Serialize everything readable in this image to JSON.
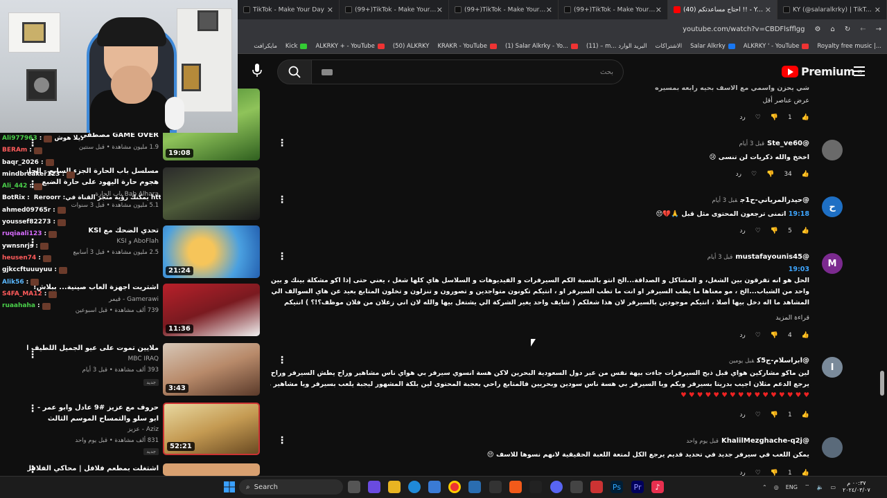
{
  "browser": {
    "tabs": [
      {
        "title": "TikTok - Make Your Day",
        "active": false
      },
      {
        "title": "(99+)TikTok - Make Your Day",
        "active": false
      },
      {
        "title": "(99+)TikTok - Make Your Day",
        "active": false
      },
      {
        "title": "(99+)TikTok - Make Your Day",
        "active": false
      },
      {
        "title": "(40) احتاج مساعدتكم !! - YouTube",
        "active": true
      },
      {
        "title": "KY (@salaralkrky) | TikTok(+99)",
        "active": false
      }
    ],
    "url": "youtube.com/watch?v=CBDFlsfflgg",
    "bookmarks": [
      "مايكرافت",
      "Kick",
      "ALKRKY + - YouTube",
      "(50) ALKRKY",
      "KRAKR - YouTube",
      "(1) Salar Alkrky - Yo...",
      "(11) – m... البريد الوارد",
      "الاشتراكات",
      "Salar Alkrky",
      "ALKRKY ' - YouTube",
      "Royalty free music |..."
    ]
  },
  "youtube": {
    "logo": "Premium",
    "logo_sup": "IQ",
    "search_placeholder": "بحث"
  },
  "chat": [
    {
      "user": "Ali977963",
      "text": "ديلا هوش",
      "color": "green"
    },
    {
      "user": "BERAm",
      "text": "",
      "color": "red"
    },
    {
      "user": "baqr_2026",
      "text": "",
      "color": "wht"
    },
    {
      "user": "mindbreaker123",
      "text": "",
      "color": "wht"
    },
    {
      "user": "Ali_442",
      "text": "",
      "color": "green"
    },
    {
      "user": "BotRix",
      "text": "Reroorr :يمكنك رؤية متجر القناة في https://botrix.live/k/alkrky99/shop",
      "color": "wht"
    },
    {
      "user": "ahmed09765r",
      "text": "",
      "color": "wht"
    },
    {
      "user": "youssef82273",
      "text": "",
      "color": "wht"
    },
    {
      "user": "ruqiaali123",
      "text": "",
      "color": "pur"
    },
    {
      "user": "ywnsnrjs",
      "text": "",
      "color": "wht"
    },
    {
      "user": "heusen74",
      "text": "",
      "color": "red"
    },
    {
      "user": "gjkccftuuuyuu",
      "text": "",
      "color": "wht"
    },
    {
      "user": "Alik56",
      "text": "",
      "color": "blu"
    },
    {
      "user": "S4FA_MA12",
      "text": "",
      "color": "red"
    },
    {
      "user": "ruaahaha",
      "text": "",
      "color": "green"
    }
  ],
  "related": [
    {
      "title": "GAME OVER مصطفى",
      "channel": "",
      "meta": "1.9 مليون مشاهدة • قبل سنتين",
      "duration": "19:08"
    },
    {
      "title": "مسلسل باب الحارة الجزء السابع - الحلقة 22",
      "title2": "هجوم حارة اليهود على حارة الضبع",
      "channel": "Bab Alhara باب الحارة",
      "meta": "5.1 مليون مشاهدة • قبل 3 سنوات",
      "duration": ""
    },
    {
      "title": "تحدي الضحك مع KSI",
      "channel": "AboFlah و KSI",
      "meta": "2.5 مليون مشاهدة • قبل 3 أسابيع",
      "duration": "21:24"
    },
    {
      "title": "اشتريت اجهزة العاب صينية... ببلاش!",
      "channel": "Gamerawi - قيمر",
      "meta": "739 ألف مشاهدة • قبل اسبوعين",
      "duration": "11:36"
    },
    {
      "title": "ملايين تموت على عيو الجميل اللطيف الجنتل",
      "channel": "MBC IRAQ",
      "meta": "393 ألف مشاهدة • قبل 3 أيام",
      "duration": "3:43",
      "new": "جديد"
    },
    {
      "title": "حروف مع عزيز #9 عادل وابو عمر -",
      "title2": "ابو سلو والتمساح الموسم الثالث",
      "channel": "Aziz - عزيز",
      "meta": "831 ألف مشاهدة • قبل يوم واحد",
      "duration": "52:21",
      "new": "جديد"
    },
    {
      "title": "اشتغلت بمطعم فلافل | محاكي الفلافل !!",
      "channel": "",
      "meta": "",
      "duration": ""
    }
  ],
  "comments": [
    {
      "user": "",
      "time": "",
      "text": "شي يحزن واسمي مع الاسف بحيه رابعه بمسيره",
      "extra": "عرض عناصر أقل",
      "likes": "1",
      "reply": "رد"
    },
    {
      "user": "@Ste_ve60",
      "time": "قبل 3 أيام",
      "text": "اخخخ والله ذكريات لن تنسى",
      "likes": "34",
      "reply": "رد"
    },
    {
      "user": "@حيدرالمرياني-ح1ج",
      "time": "قبل 3 أيام",
      "ts": "19:18",
      "text": "اتمنى ترجعون المحتوى مثل قبل",
      "likes": "5",
      "reply": "رد"
    },
    {
      "user": "@mustafayounis45",
      "time": "قبل 3 أيام",
      "ts": "19:03",
      "text": "الحل هو انه تفرقون بين الشغل، و المشاكل و الصداقة...الخ انتو بالنسبة الكم السيرفرات و الفيديوهات و السلاسل هاي كلها شغل ، يعني حتى إذا اكو مشكلة بينك و بين واحد من الشباب...الخ ، مو معناها ما يطب السيرفر او انت ما تطب السيرفر او ، انتيكم تكونون متواجدين و تصورون و تنزلون و تخلون المتابع بعيد عن هاي السوالف الي المشاهد ما اله دخل بيها أصلا ، انتيكم موجودين بالسيرفر لان هذا شغلكم ( شايف واحد يغير الشركة الي يشتغل بيها والله لان اني زعلان من فلان موظف؟!؟ ) انتيكم موجودين بالسيرفر تنزلون محتوى حلو عادي ولا كانما اكو شي و لكن مثلا إذا انتو صدق متزاعلين لا تنزلون فيديوهات سوية و بنفس الوقت لا تحاول تبتعد..",
      "more": "قراءة المزيد",
      "likes": "4",
      "reply": "رد"
    },
    {
      "user": "@ابراسلام-ج5ك",
      "time": "قبل يومين",
      "text": "لين ماكو مشاركين هواي قبل ذبح السيرفرات جاءت بيهة نفس من عير دول السعودية البحرين لاكن هسة انسوي سيرفر بي هواي ناس مشاهير وراح يطش السيرفر وراح يرجع الدعم مثلان اجيب بدريتا بسيرفر ويكم ويا السيرفر بي هسة ناس سودين وبحريين فالمتابع راحي بعجبة المحتوى لين بلكة المشهور ليجبة يلعب بسيرفر ويا مشاهير من عير دول وهيجي راح يشهر السيرفر فحاول جيب مشاهير من عير دول الخليج وبس",
      "likes": "1",
      "reply": "رد"
    },
    {
      "user": "@KhalilMezghache-q2j",
      "time": "قبل يوم واحد",
      "text": "يمكن اللعب في سيرفر جديد في تحديد قديم يرجع الكل لمتعة اللعبة الحقيقية لانهم نسوها للاسف",
      "likes": "1",
      "reply": "رد"
    }
  ],
  "taskbar": {
    "search": "Search",
    "lang": "ENG",
    "time": "٠٠:٣٧ م",
    "date": "٢٠٢٤/٠٣/٠٧"
  }
}
